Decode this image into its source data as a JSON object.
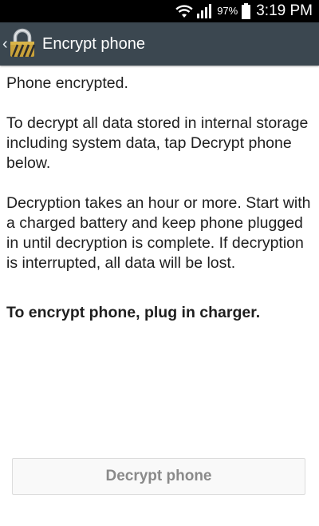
{
  "status_bar": {
    "battery_percent": "97%",
    "time": "3:19 PM"
  },
  "action_bar": {
    "back_glyph": "‹",
    "title": "Encrypt phone",
    "icon": "lock-icon"
  },
  "content": {
    "status_line": "Phone encrypted.",
    "instructions": "To decrypt all data stored in internal storage including system data, tap Decrypt phone below.",
    "warning": "Decryption takes an hour or more. Start with a charged battery and keep phone plugged in until decryption is complete. If decryption is interrupted, all data will be lost.",
    "charger_notice": "To encrypt phone, plug in charger."
  },
  "decrypt_button": {
    "label": "Decrypt phone",
    "enabled": false
  },
  "colors": {
    "action_bar": "#3b4750",
    "status_bar": "#000000",
    "button_text_disabled": "#8a8a8a"
  }
}
